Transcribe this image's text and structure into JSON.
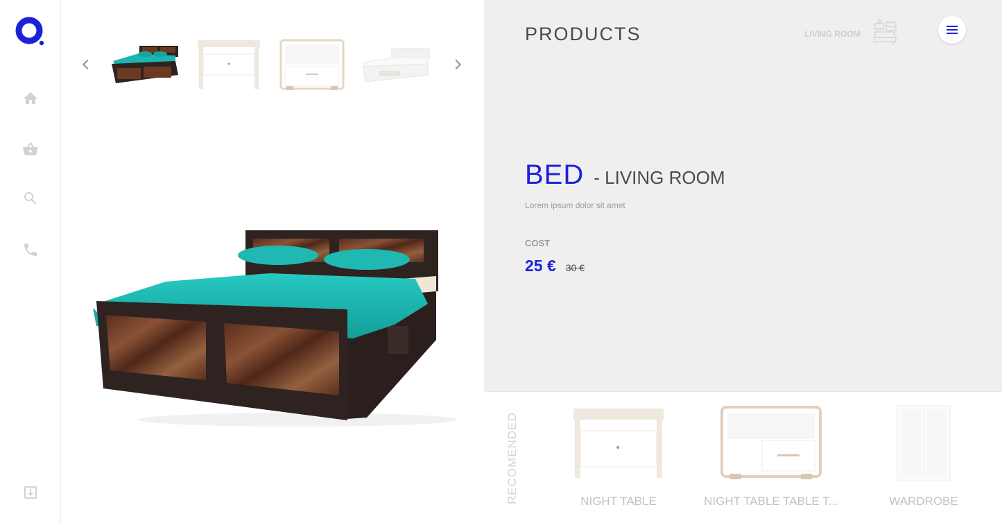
{
  "sidebar": {
    "logo_icon": "brand-logo-icon",
    "nav": [
      {
        "icon": "home-icon"
      },
      {
        "icon": "basket-icon"
      },
      {
        "icon": "search-icon"
      },
      {
        "icon": "phone-icon"
      }
    ],
    "bottom_icon": "download-icon"
  },
  "gallery": {
    "prev_icon": "chevron-left-icon",
    "next_icon": "chevron-right-icon",
    "thumbnails": [
      "bed-thumbnail",
      "night-table-thumbnail",
      "night-table-drawer-thumbnail",
      "white-bed-thumbnail"
    ],
    "main_image": "bed-main-image"
  },
  "header": {
    "title": "PRODUCTS",
    "breadcrumb": "LIVING ROOM",
    "room_icon": "living-room-icon",
    "menu_icon": "hamburger-menu-icon"
  },
  "product": {
    "name": "BED",
    "category": "- LIVING ROOM",
    "description": "Lorem ipsum dolor sit amet",
    "cost_label": "COST",
    "price": "25 €",
    "old_price": "30 €"
  },
  "recommended": {
    "label": "RECOMENDED",
    "items": [
      {
        "name": "NIGHT TABLE"
      },
      {
        "name": "NIGHT TABLE TABLE T..."
      },
      {
        "name": "WARDROBE"
      }
    ]
  },
  "colors": {
    "accent": "#1c22d8",
    "panel_bg": "#efefef",
    "icon_gray": "#d2d2d2",
    "bed_teal": "#1cb5b0",
    "bed_wood": "#2e2320"
  }
}
